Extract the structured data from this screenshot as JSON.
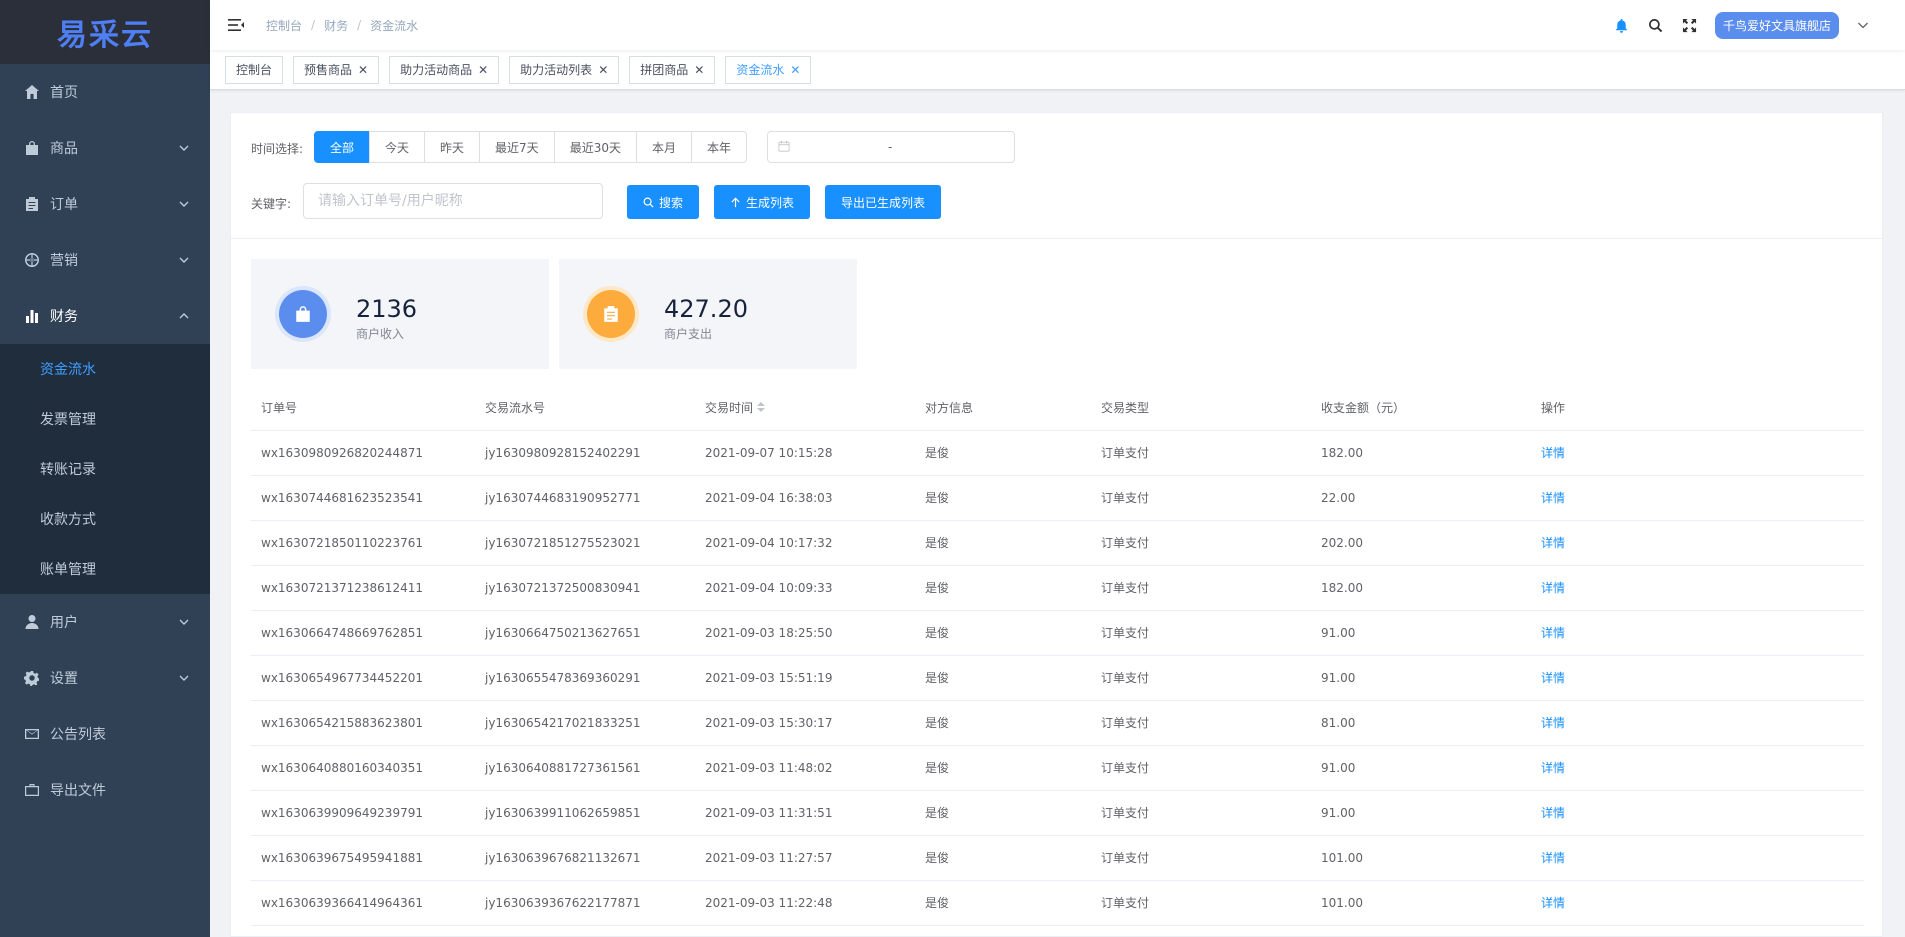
{
  "app": {
    "logo": "易采云"
  },
  "sidebar": {
    "items": [
      {
        "label": "首页",
        "icon": "home-icon",
        "chevron": false
      },
      {
        "label": "商品",
        "icon": "shopping-bag-icon",
        "chevron": "down"
      },
      {
        "label": "订单",
        "icon": "clipboard-icon",
        "chevron": "down"
      },
      {
        "label": "营销",
        "icon": "dharma-wheel-icon",
        "chevron": "down"
      },
      {
        "label": "财务",
        "icon": "bar-chart-icon",
        "chevron": "up"
      }
    ],
    "finance_sub": [
      "资金流水",
      "发票管理",
      "转账记录",
      "收款方式",
      "账单管理"
    ],
    "bottom_items": [
      {
        "label": "用户",
        "icon": "user-icon",
        "chevron": "down"
      },
      {
        "label": "设置",
        "icon": "gear-icon",
        "chevron": "down"
      },
      {
        "label": "公告列表",
        "icon": "mail-icon",
        "chevron": false
      },
      {
        "label": "导出文件",
        "icon": "briefcase-icon",
        "chevron": false
      }
    ]
  },
  "breadcrumb": [
    "控制台",
    "财务",
    "资金流水"
  ],
  "navbar": {
    "store": "千鸟爱好文具旗舰店"
  },
  "tags": [
    {
      "label": "控制台",
      "closable": false
    },
    {
      "label": "预售商品",
      "closable": true
    },
    {
      "label": "助力活动商品",
      "closable": true
    },
    {
      "label": "助力活动列表",
      "closable": true
    },
    {
      "label": "拼团商品",
      "closable": true
    },
    {
      "label": "资金流水",
      "closable": true,
      "active": true
    }
  ],
  "filter": {
    "time_label": "时间选择:",
    "time_options": [
      "全部",
      "今天",
      "昨天",
      "最近7天",
      "最近30天",
      "本月",
      "本年"
    ],
    "selected_time": "全部",
    "date_sep": "-",
    "keyword_label": "关键字:",
    "keyword_placeholder": "请输入订单号/用户昵称",
    "search_btn": "搜索",
    "generate_btn": "生成列表",
    "export_btn": "导出已生成列表"
  },
  "stats": [
    {
      "value": "2136",
      "label": "商户收入",
      "color": "#5a8dee",
      "icon": "shopping-bag-icon"
    },
    {
      "value": "427.20",
      "label": "商户支出",
      "color": "#fdab3c",
      "icon": "clipboard-icon"
    }
  ],
  "table": {
    "headers": [
      "订单号",
      "交易流水号",
      "交易时间",
      "对方信息",
      "交易类型",
      "收支金额（元）",
      "操作"
    ],
    "rows": [
      [
        "wx1630980926820244871",
        "jy1630980928152402291",
        "2021-09-07 10:15:28",
        "是俊",
        "订单支付",
        "182.00",
        "详情"
      ],
      [
        "wx1630744681623523541",
        "jy1630744683190952771",
        "2021-09-04 16:38:03",
        "是俊",
        "订单支付",
        "22.00",
        "详情"
      ],
      [
        "wx1630721850110223761",
        "jy1630721851275523021",
        "2021-09-04 10:17:32",
        "是俊",
        "订单支付",
        "202.00",
        "详情"
      ],
      [
        "wx1630721371238612411",
        "jy1630721372500830941",
        "2021-09-04 10:09:33",
        "是俊",
        "订单支付",
        "182.00",
        "详情"
      ],
      [
        "wx1630664748669762851",
        "jy1630664750213627651",
        "2021-09-03 18:25:50",
        "是俊",
        "订单支付",
        "91.00",
        "详情"
      ],
      [
        "wx1630654967734452201",
        "jy1630655478369360291",
        "2021-09-03 15:51:19",
        "是俊",
        "订单支付",
        "91.00",
        "详情"
      ],
      [
        "wx1630654215883623801",
        "jy1630654217021833251",
        "2021-09-03 15:30:17",
        "是俊",
        "订单支付",
        "81.00",
        "详情"
      ],
      [
        "wx1630640880160340351",
        "jy1630640881727361561",
        "2021-09-03 11:48:02",
        "是俊",
        "订单支付",
        "91.00",
        "详情"
      ],
      [
        "wx1630639909649239791",
        "jy1630639911062659851",
        "2021-09-03 11:31:51",
        "是俊",
        "订单支付",
        "91.00",
        "详情"
      ],
      [
        "wx1630639675495941881",
        "jy1630639676821132671",
        "2021-09-03 11:27:57",
        "是俊",
        "订单支付",
        "101.00",
        "详情"
      ],
      [
        "wx1630639366414964361",
        "jy1630639367622177871",
        "2021-09-03 11:22:48",
        "是俊",
        "订单支付",
        "101.00",
        "详情"
      ]
    ]
  }
}
